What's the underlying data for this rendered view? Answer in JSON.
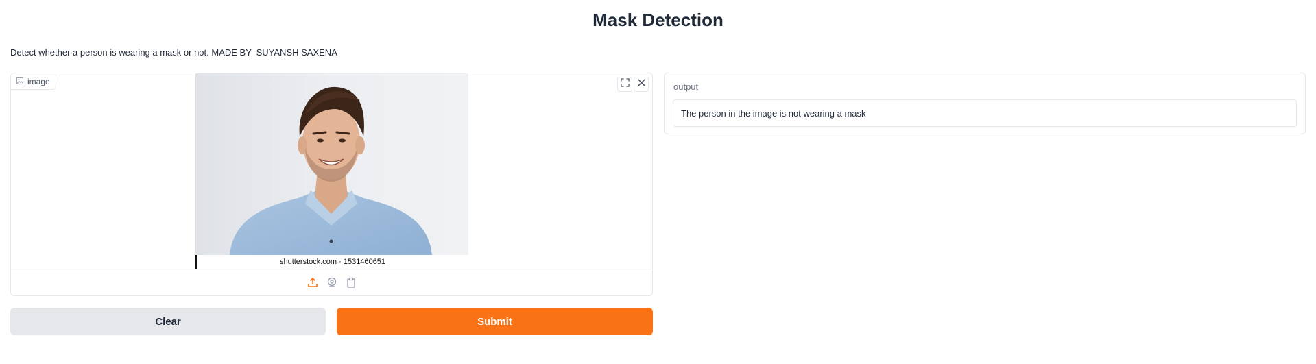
{
  "app": {
    "title": "Mask Detection",
    "description": "Detect whether a person is wearing a mask or not. MADE BY- SUYANSH SAXENA"
  },
  "image_input": {
    "label": "image",
    "label_icon": "image-icon",
    "fullscreen_icon": "fullscreen-icon",
    "close_icon": "close-icon",
    "photo_caption": "shutterstock.com · 1531460651",
    "sources": [
      {
        "icon": "upload-icon",
        "active": true
      },
      {
        "icon": "webcam-icon",
        "active": false
      },
      {
        "icon": "clipboard-icon",
        "active": false
      }
    ]
  },
  "buttons": {
    "clear_label": "Clear",
    "submit_label": "Submit"
  },
  "output": {
    "label": "output",
    "value": "The person in the image is not wearing a mask"
  },
  "colors": {
    "accent": "#f97316",
    "secondary_button": "#e5e7eb",
    "border": "#e5e7eb"
  }
}
